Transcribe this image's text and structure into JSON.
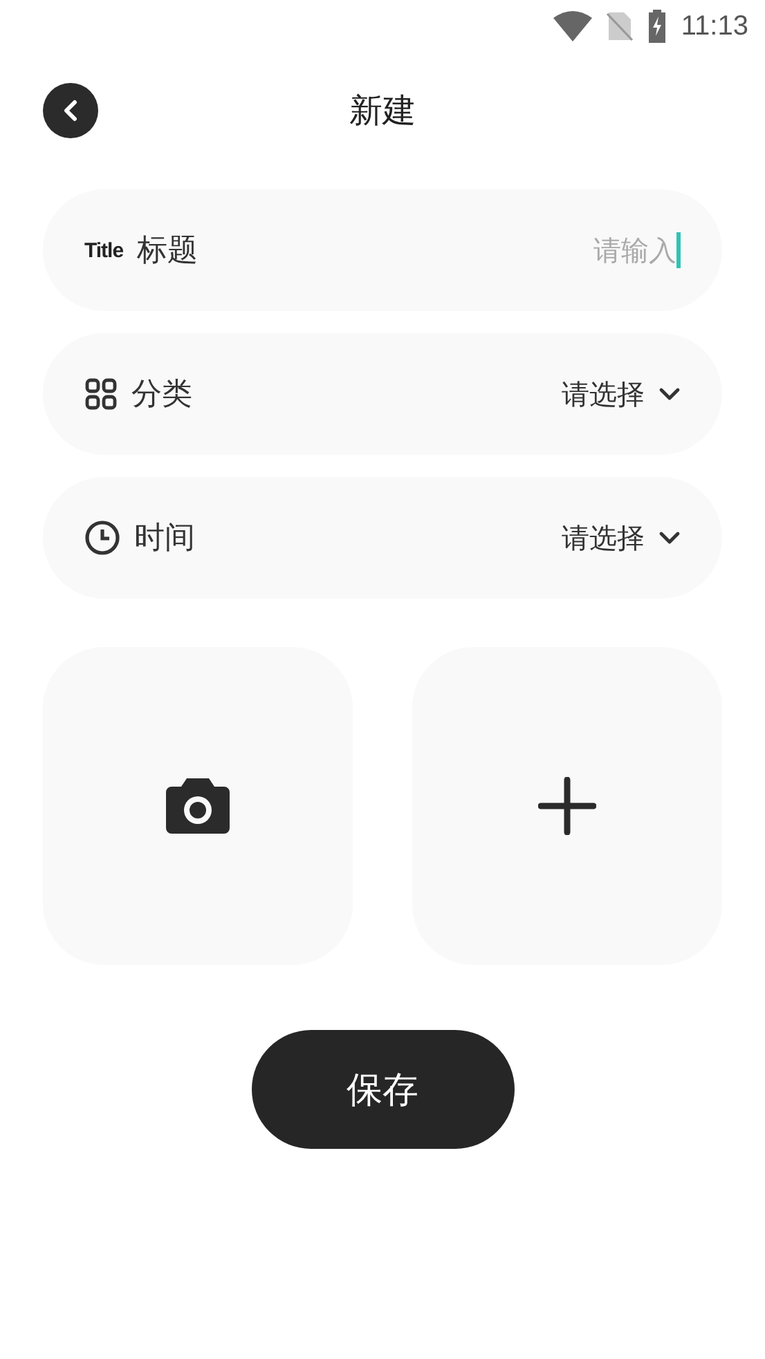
{
  "status_bar": {
    "time": "11:13"
  },
  "header": {
    "title": "新建"
  },
  "fields": [
    {
      "kind": "input",
      "badge": "Title",
      "label": "标题",
      "placeholder": "请输入",
      "focused": true
    },
    {
      "kind": "category",
      "label": "分类",
      "value": "请选择"
    },
    {
      "kind": "time",
      "label": "时间",
      "value": "请选择"
    }
  ],
  "tiles": [
    {
      "kind": "camera"
    },
    {
      "kind": "add"
    }
  ],
  "save_button": {
    "label": "保存"
  }
}
